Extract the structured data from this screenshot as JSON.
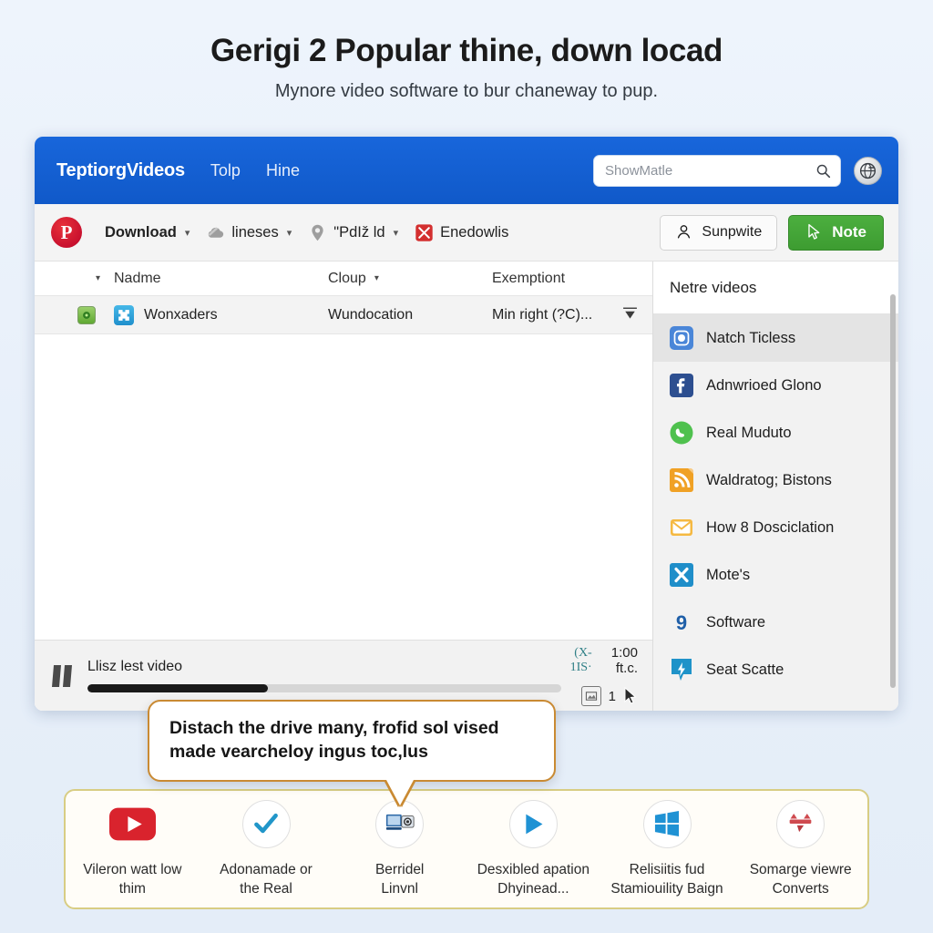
{
  "page": {
    "headline": "Gerigi 2 Popular thine, down locad",
    "subheadline": "Mynore video software to bur chaneway to pup."
  },
  "window": {
    "topbar": {
      "brand": "TeptiorgVideos",
      "nav": [
        {
          "label": "Tolp"
        },
        {
          "label": "Hine"
        }
      ],
      "search_placeholder": "ShowMatle",
      "search_icon": "search-icon",
      "globe_icon": "globe-icon"
    },
    "toolbar": {
      "logo_icon": "pinterest-logo-icon",
      "logo_glyph": "P",
      "buttons": [
        {
          "label": "Download",
          "icon": "download-icon",
          "caret": "▾"
        },
        {
          "label": "lineses",
          "icon": "cloud-icon",
          "caret": "▾"
        },
        {
          "label": "\"PdIž ld",
          "icon": "location-pin-icon",
          "caret": "▾"
        },
        {
          "label": "Enedowlis",
          "icon": "cut-tool-icon",
          "caret": ""
        }
      ],
      "outline_button": {
        "label": "Sunpwite",
        "icon": "person-icon"
      },
      "green_button": {
        "label": "Note",
        "icon": "cursor-note-icon"
      }
    },
    "table": {
      "columns": [
        {
          "key": "select",
          "label": "",
          "sort": "▾"
        },
        {
          "key": "name",
          "label": "Nadme"
        },
        {
          "key": "cloud",
          "label": "Cloup",
          "sort": "▾"
        },
        {
          "key": "exemption",
          "label": "Exemptiont"
        }
      ],
      "rows": [
        {
          "status_icon": "green-disk-icon",
          "type_icon": "blue-puzzle-icon",
          "name": "Wonxaders",
          "cloud": "Wundocation",
          "exemption": "Min right (?C)...",
          "row_menu_icon": "filter-icon"
        }
      ]
    },
    "player": {
      "pause_icon": "pause-icon",
      "title": "Llisz lest video",
      "speed": "(X-1IS·",
      "time": "1:00 ft.c.",
      "progress_percent": 38,
      "capture_icon": "screenshot-icon",
      "count": "1",
      "cursor_icon": "mouse-cursor-icon"
    },
    "panel": {
      "header": "Netre videos",
      "items": [
        {
          "label": "Natch Ticless",
          "icon": "instagram-icon",
          "active": true
        },
        {
          "label": "Adnwrioed Glono",
          "icon": "facebook-icon",
          "active": false
        },
        {
          "label": "Real Muduto",
          "icon": "whatsapp-icon",
          "active": false
        },
        {
          "label": "Waldratog; Bistons",
          "icon": "rss-feed-icon",
          "active": false
        },
        {
          "label": "How 8 Dosciclation",
          "icon": "email-envelope-icon",
          "active": false
        },
        {
          "label": "Mote's",
          "icon": "x-twitter-icon",
          "active": false
        },
        {
          "label": "Software",
          "icon": "nine-badge-icon",
          "active": false
        },
        {
          "label": "Seat Scatte",
          "icon": "news-pin-icon",
          "active": false
        }
      ],
      "scrollbar": "vertical-scrollbar"
    }
  },
  "callout": {
    "line1": "Distach the drive many, frofid sol vised",
    "line2": "made vearcheloy ingus toc,lus"
  },
  "features": [
    {
      "icon": "youtube-icon",
      "label_line1": "Vileron watt low",
      "label_line2": "thim"
    },
    {
      "icon": "check-mark-icon",
      "label_line1": "Adonamade or",
      "label_line2": "the Real"
    },
    {
      "icon": "screen-devices-icon",
      "label_line1": "Berridel",
      "label_line2": "Linvnl"
    },
    {
      "icon": "play-triangle-icon",
      "label_line1": "Desxibled apation",
      "label_line2": "Dhyinead..."
    },
    {
      "icon": "windows-icon",
      "label_line1": "Relisiitis fud",
      "label_line2": "Stamiouility Baign"
    },
    {
      "icon": "converter-icon",
      "label_line1": "Somarge viewre",
      "label_line2": "Converts"
    }
  ],
  "colors": {
    "topbar_blue": "#1565d8",
    "green_button": "#3d9c31",
    "callout_border": "#c98a33",
    "features_border": "#d8cd84",
    "page_background": "#eaf1fb"
  }
}
